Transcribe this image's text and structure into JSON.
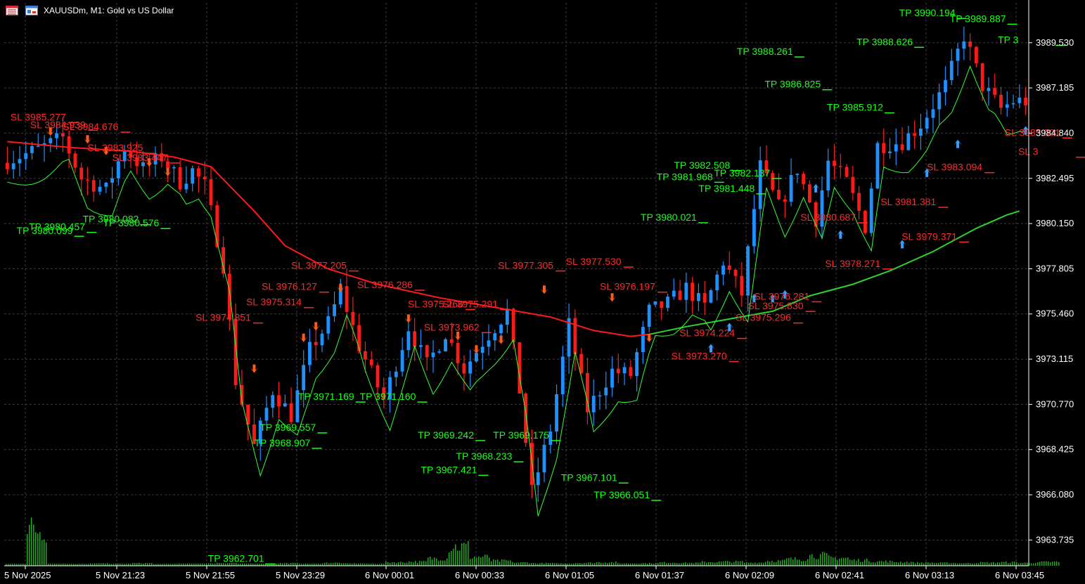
{
  "header": {
    "symbol": "XAUUSDm",
    "timeframe": "M1",
    "title": "XAUUSDm, M1:  Gold vs US Dollar",
    "icons": [
      "chart-list-icon",
      "chart-window-icon"
    ]
  },
  "colors": {
    "background": "#000000",
    "grid": "#3c3c3c",
    "axis_text": "#ffffff",
    "bull_candle": "#1e90ff",
    "bear_candle": "#ff1a1a",
    "tp_label": "#1aff1a",
    "sl_label": "#ff2a2a",
    "ma_slow": "#ff1a1a",
    "ma_trend": "#2fd02f",
    "trail_line": "#33ff33",
    "sell_arrow": "#ff5a1a",
    "buy_arrow": "#3a9cff",
    "volume": "#22aa22"
  },
  "chart_data": {
    "type": "candlestick",
    "ylim": [
      3962.4,
      3991.6
    ],
    "y_ticks": [
      "3989.530",
      "3987.185",
      "3984.840",
      "3982.495",
      "3980.150",
      "3977.805",
      "3975.460",
      "3973.115",
      "3970.770",
      "3968.425",
      "3966.080",
      "3963.735"
    ],
    "x_ticks": [
      "5 Nov 2025",
      "5 Nov 21:23",
      "5 Nov 21:55",
      "5 Nov 23:29",
      "6 Nov 00:01",
      "6 Nov 00:33",
      "6 Nov 01:05",
      "6 Nov 01:37",
      "6 Nov 02:09",
      "6 Nov 02:41",
      "6 Nov 03:13",
      "6 Nov 03:45"
    ],
    "price_path": [
      [
        0,
        3983.3
      ],
      [
        6,
        3984.0
      ],
      [
        10,
        3984.6
      ],
      [
        13,
        3982.5
      ],
      [
        17,
        3981.9
      ],
      [
        20,
        3984.1
      ],
      [
        23,
        3983.0
      ],
      [
        26,
        3983.6
      ],
      [
        29,
        3982.3
      ],
      [
        31,
        3982.9
      ],
      [
        33,
        3982.1
      ],
      [
        36,
        3978.0
      ],
      [
        38,
        3972.0
      ],
      [
        41,
        3968.6
      ],
      [
        44,
        3971.5
      ],
      [
        47,
        3970.2
      ],
      [
        50,
        3973.6
      ],
      [
        53,
        3975.0
      ],
      [
        55,
        3976.7
      ],
      [
        58,
        3973.8
      ],
      [
        62,
        3971.0
      ],
      [
        66,
        3974.8
      ],
      [
        69,
        3972.8
      ],
      [
        72,
        3974.5
      ],
      [
        75,
        3972.6
      ],
      [
        78,
        3974.0
      ],
      [
        82,
        3975.6
      ],
      [
        84,
        3971.5
      ],
      [
        86,
        3966.2
      ],
      [
        89,
        3969.5
      ],
      [
        92,
        3974.9
      ],
      [
        95,
        3970.5
      ],
      [
        99,
        3972.5
      ],
      [
        102,
        3972.3
      ],
      [
        105,
        3975.6
      ],
      [
        108,
        3976.0
      ],
      [
        111,
        3976.8
      ],
      [
        114,
        3975.8
      ],
      [
        117,
        3978.2
      ],
      [
        120,
        3976.5
      ],
      [
        123,
        3983.1
      ],
      [
        126,
        3981.0
      ],
      [
        129,
        3983.0
      ],
      [
        132,
        3980.4
      ],
      [
        134,
        3983.4
      ],
      [
        137,
        3982.3
      ],
      [
        140,
        3980.0
      ],
      [
        142,
        3984.2
      ],
      [
        146,
        3984.4
      ],
      [
        149,
        3985.3
      ],
      [
        153,
        3987.3
      ],
      [
        156,
        3989.9
      ],
      [
        159,
        3987.3
      ],
      [
        162,
        3986.1
      ],
      [
        164,
        3986.5
      ]
    ],
    "ma_slow": [
      [
        0,
        3984.4
      ],
      [
        10,
        3984.1
      ],
      [
        20,
        3983.9
      ],
      [
        27,
        3983.6
      ],
      [
        33,
        3983.1
      ],
      [
        40,
        3980.8
      ],
      [
        45,
        3979.0
      ],
      [
        52,
        3977.8
      ],
      [
        60,
        3977.0
      ],
      [
        70,
        3976.3
      ],
      [
        79,
        3975.8
      ],
      [
        88,
        3975.3
      ],
      [
        95,
        3974.6
      ],
      [
        101,
        3974.3
      ],
      [
        104,
        3974.4
      ]
    ],
    "ma_trend": [
      [
        104,
        3974.4
      ],
      [
        110,
        3974.8
      ],
      [
        117,
        3975.2
      ],
      [
        124,
        3975.6
      ],
      [
        130,
        3976.4
      ],
      [
        137,
        3977.0
      ],
      [
        143,
        3977.7
      ],
      [
        150,
        3978.7
      ],
      [
        157,
        3979.9
      ],
      [
        162,
        3980.6
      ],
      [
        164,
        3980.8
      ]
    ],
    "volume": [
      0,
      120,
      2,
      1,
      3,
      2,
      4,
      1,
      2,
      3,
      5,
      2,
      3,
      4,
      2,
      5,
      3,
      2,
      7,
      9,
      20,
      60,
      25,
      12,
      6,
      4,
      3,
      5,
      7,
      3,
      4,
      6,
      5,
      8,
      9,
      6,
      12,
      18,
      30,
      22,
      14,
      10,
      8,
      6,
      5,
      4,
      6,
      7,
      5,
      8
    ],
    "tp_labels": [
      {
        "text": "TP 3990.194",
        "x": 144.5,
        "y": 3990.9
      },
      {
        "text": "TP 3989.887",
        "x": 152.7,
        "y": 3990.6
      },
      {
        "text": "TP 3",
        "x": 160.5,
        "y": 3989.5
      },
      {
        "text": "TP 3988.626",
        "x": 137.6,
        "y": 3989.4
      },
      {
        "text": "TP 3988.261",
        "x": 118.2,
        "y": 3988.9
      },
      {
        "text": "TP 3986.825",
        "x": 122.7,
        "y": 3987.2
      },
      {
        "text": "TP 3985.912",
        "x": 132.8,
        "y": 3986.0
      },
      {
        "text": "TP 3982.508",
        "x": 108.0,
        "y": 3983.0
      },
      {
        "text": "TP 3982.137",
        "x": 114.5,
        "y": 3982.6
      },
      {
        "text": "TP 3981.968",
        "x": 105.2,
        "y": 3982.4
      },
      {
        "text": "TP 3981.448",
        "x": 112.0,
        "y": 3981.8
      },
      {
        "text": "TP 3980.021",
        "x": 102.6,
        "y": 3980.3
      },
      {
        "text": "TP 3980.099",
        "x": 1.5,
        "y": 3979.6
      },
      {
        "text": "TP 3980.457",
        "x": 3.5,
        "y": 3979.8
      },
      {
        "text": "TP 3980.082",
        "x": 12.2,
        "y": 3980.2
      },
      {
        "text": "TP 3980.576",
        "x": 15.5,
        "y": 3980.0
      },
      {
        "text": "TP 3971.169",
        "x": 47.1,
        "y": 3971.0
      },
      {
        "text": "TP 3971.160",
        "x": 57.1,
        "y": 3971.0
      },
      {
        "text": "TP 3969.557",
        "x": 40.9,
        "y": 3969.4
      },
      {
        "text": "TP 3968.907",
        "x": 40.0,
        "y": 3968.6
      },
      {
        "text": "TP 3969.242",
        "x": 66.5,
        "y": 3969.0
      },
      {
        "text": "TP 3969.175",
        "x": 78.7,
        "y": 3969.0
      },
      {
        "text": "TP 3968.233",
        "x": 72.7,
        "y": 3967.9
      },
      {
        "text": "TP 3967.421",
        "x": 67.0,
        "y": 3967.2
      },
      {
        "text": "TP 3967.101",
        "x": 89.7,
        "y": 3966.8
      },
      {
        "text": "TP 3966.051",
        "x": 95.0,
        "y": 3965.9
      },
      {
        "text": "TP 3962.701",
        "x": 32.5,
        "y": 3962.6
      }
    ],
    "sl_labels": [
      {
        "text": "SL 3985.277",
        "x": 0.5,
        "y": 3985.5
      },
      {
        "text": "SL 3984.939",
        "x": 3.7,
        "y": 3985.1
      },
      {
        "text": "SL 3984.676",
        "x": 9.0,
        "y": 3985.0
      },
      {
        "text": "SL 3983.925",
        "x": 13.0,
        "y": 3983.9
      },
      {
        "text": "SL 3983.447",
        "x": 17.0,
        "y": 3983.4
      },
      {
        "text": "SL 3977.205",
        "x": 46.0,
        "y": 3977.8
      },
      {
        "text": "SL 3976.127",
        "x": 41.2,
        "y": 3976.7
      },
      {
        "text": "SL 3975.314",
        "x": 38.7,
        "y": 3975.9
      },
      {
        "text": "SL 3974.851",
        "x": 30.5,
        "y": 3975.1
      },
      {
        "text": "SL 3976.286",
        "x": 56.7,
        "y": 3976.8
      },
      {
        "text": "SL 3975.266",
        "x": 64.9,
        "y": 3975.8
      },
      {
        "text": "SL 3975.291",
        "x": 70.5,
        "y": 3975.8
      },
      {
        "text": "SL 3973.962",
        "x": 67.5,
        "y": 3974.6
      },
      {
        "text": "SL 3977.305",
        "x": 79.5,
        "y": 3977.8
      },
      {
        "text": "SL 3977.530",
        "x": 90.5,
        "y": 3978.0
      },
      {
        "text": "SL 3976.197",
        "x": 96.0,
        "y": 3976.7
      },
      {
        "text": "SL 3974.224",
        "x": 108.9,
        "y": 3974.3
      },
      {
        "text": "SL 3973.270",
        "x": 107.6,
        "y": 3973.1
      },
      {
        "text": "SL 3976.281",
        "x": 121.0,
        "y": 3976.2
      },
      {
        "text": "SL 3975.830",
        "x": 120.0,
        "y": 3975.7
      },
      {
        "text": "SL 3975.296",
        "x": 118.0,
        "y": 3975.1
      },
      {
        "text": "SL 3978.271",
        "x": 132.5,
        "y": 3977.9
      },
      {
        "text": "SL 3980.687",
        "x": 128.5,
        "y": 3980.3
      },
      {
        "text": "SL 3981.381",
        "x": 141.5,
        "y": 3981.1
      },
      {
        "text": "SL 3979.371",
        "x": 144.9,
        "y": 3979.3
      },
      {
        "text": "SL 3983.094",
        "x": 149.0,
        "y": 3982.9
      },
      {
        "text": "SL 3985.001",
        "x": 161.6,
        "y": 3984.7
      },
      {
        "text": "SL 3",
        "x": 163.8,
        "y": 3983.7
      }
    ],
    "sell_arrows": [
      [
        7,
        3984.7
      ],
      [
        13,
        3984.3
      ],
      [
        16,
        3983.7
      ],
      [
        23,
        3983.1
      ],
      [
        26,
        3982.6
      ],
      [
        40,
        3972.4
      ],
      [
        48,
        3974.0
      ],
      [
        50,
        3974.6
      ],
      [
        54,
        3976.6
      ],
      [
        65,
        3975.0
      ],
      [
        73,
        3974.1
      ],
      [
        76,
        3973.4
      ],
      [
        80,
        3973.9
      ],
      [
        87,
        3976.5
      ],
      [
        98,
        3976.1
      ],
      [
        104,
        3974.0
      ]
    ],
    "buy_arrows": [
      [
        114,
        3973.9
      ],
      [
        117,
        3975.0
      ],
      [
        121,
        3976.5
      ],
      [
        124,
        3976.5
      ],
      [
        126,
        3976.7
      ],
      [
        131,
        3982.2
      ],
      [
        135,
        3979.8
      ],
      [
        145,
        3979.3
      ],
      [
        149,
        3983.0
      ],
      [
        154,
        3984.5
      ],
      [
        165,
        3985.2
      ]
    ]
  }
}
